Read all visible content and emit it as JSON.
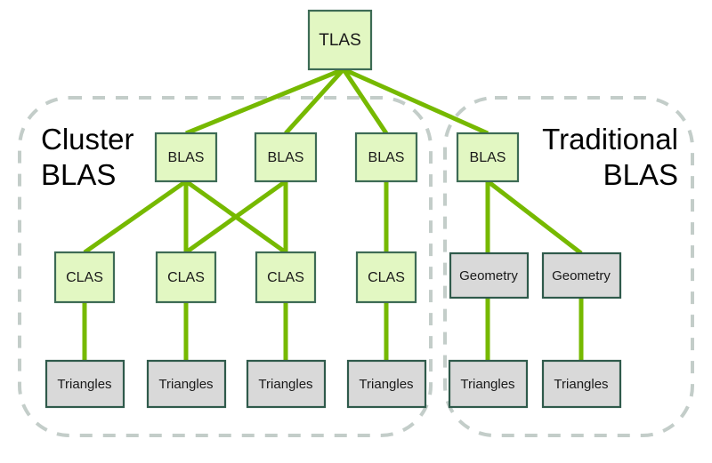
{
  "diagram": {
    "title_cluster_line1": "Cluster",
    "title_cluster_line2": "BLAS",
    "title_traditional_line1": "Traditional",
    "title_traditional_line2": "BLAS",
    "colors": {
      "link": "#76b900",
      "node_green_fill": "#e2f7c2",
      "node_green_stroke": "#3d6b55",
      "node_gray_fill": "#d9d9d9",
      "node_gray_stroke": "#2f5a4b",
      "frame_dash": "#c3cdc9",
      "background": "#ffffff",
      "text": "#1a1a1a"
    },
    "nodes": {
      "tlas": "TLAS",
      "blas_c1": "BLAS",
      "blas_c2": "BLAS",
      "blas_c3": "BLAS",
      "blas_t1": "BLAS",
      "clas1": "CLAS",
      "clas2": "CLAS",
      "clas3": "CLAS",
      "clas4": "CLAS",
      "geometry1": "Geometry",
      "geometry2": "Geometry",
      "triangles1": "Triangles",
      "triangles2": "Triangles",
      "triangles3": "Triangles",
      "triangles4": "Triangles",
      "triangles5": "Triangles",
      "triangles6": "Triangles"
    },
    "edges": [
      {
        "from": "tlas",
        "to": "blas_c1"
      },
      {
        "from": "tlas",
        "to": "blas_c2"
      },
      {
        "from": "tlas",
        "to": "blas_c3"
      },
      {
        "from": "tlas",
        "to": "blas_t1"
      },
      {
        "from": "blas_c1",
        "to": "clas1"
      },
      {
        "from": "blas_c1",
        "to": "clas2"
      },
      {
        "from": "blas_c1",
        "to": "clas3"
      },
      {
        "from": "blas_c2",
        "to": "clas2"
      },
      {
        "from": "blas_c2",
        "to": "clas3"
      },
      {
        "from": "blas_c3",
        "to": "clas4"
      },
      {
        "from": "clas1",
        "to": "triangles1"
      },
      {
        "from": "clas2",
        "to": "triangles2"
      },
      {
        "from": "clas3",
        "to": "triangles3"
      },
      {
        "from": "clas4",
        "to": "triangles4"
      },
      {
        "from": "blas_t1",
        "to": "geometry1"
      },
      {
        "from": "blas_t1",
        "to": "geometry2"
      },
      {
        "from": "geometry1",
        "to": "triangles5"
      },
      {
        "from": "geometry2",
        "to": "triangles6"
      }
    ]
  }
}
